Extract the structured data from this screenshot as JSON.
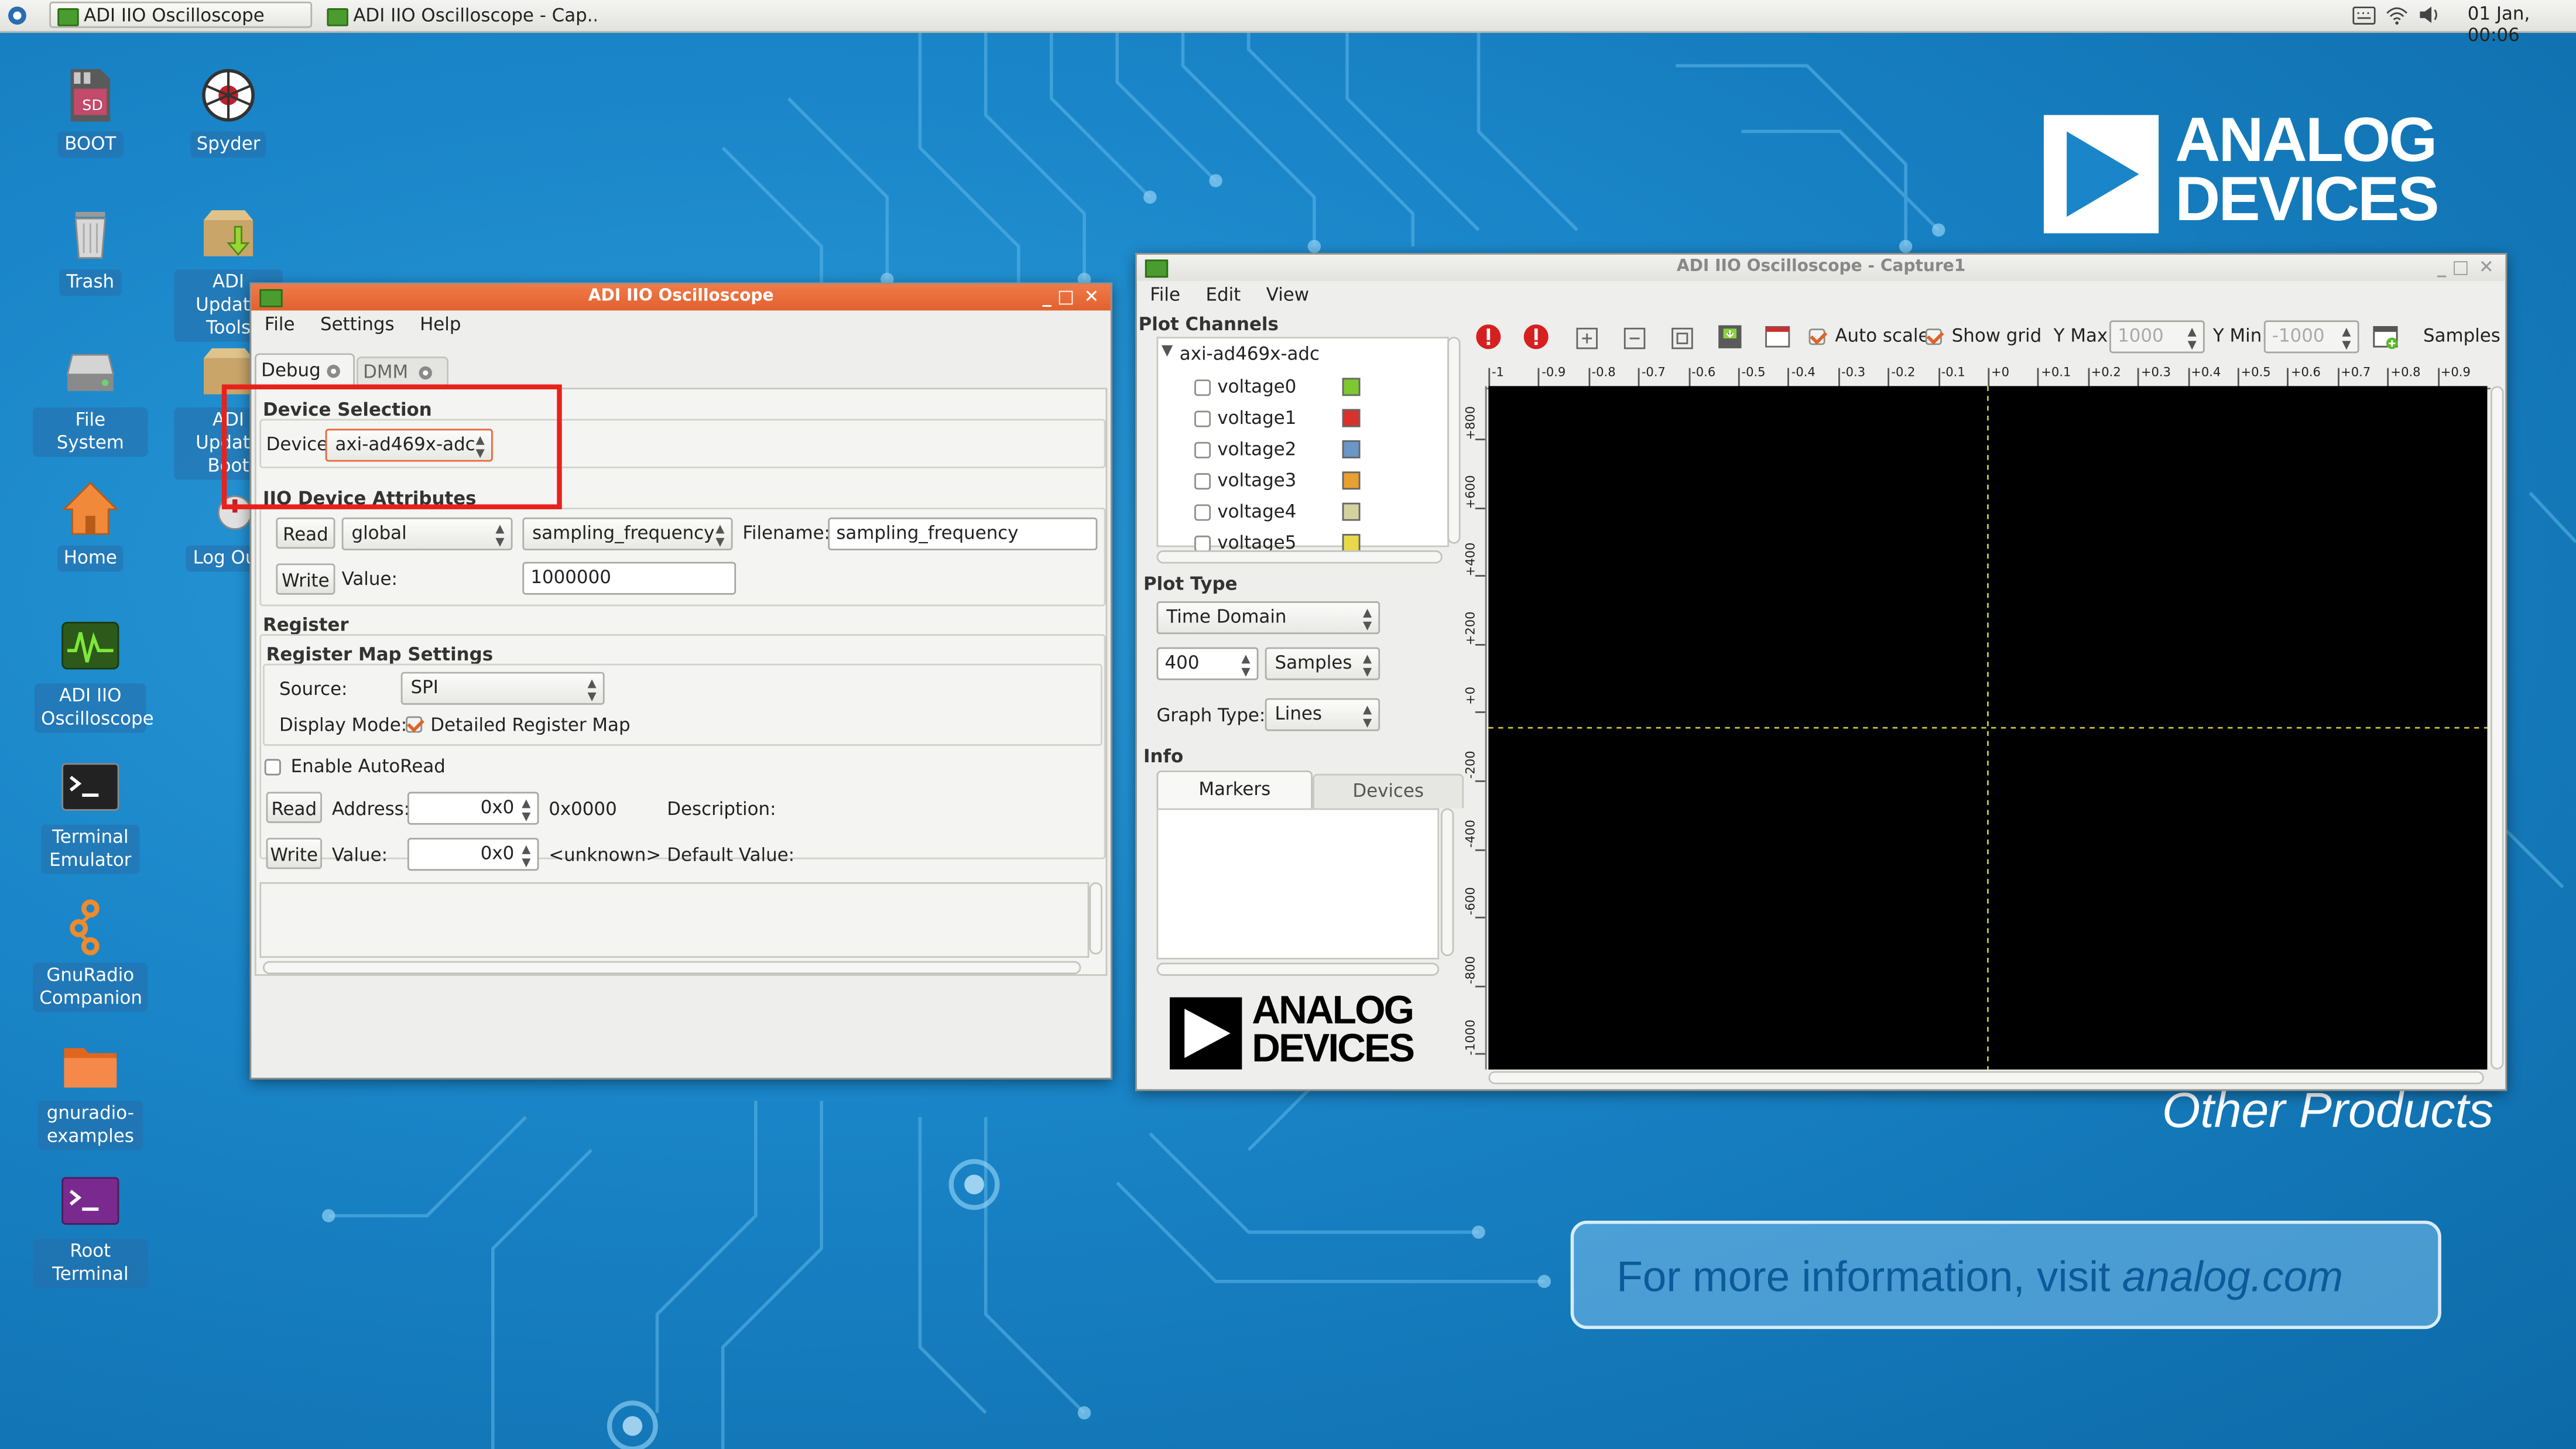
{
  "taskbar": {
    "tasks": [
      "ADI IIO Oscilloscope",
      "ADI IIO Oscilloscope - Cap..."
    ],
    "clock": "01 Jan, 00:06"
  },
  "desktop_icons": [
    {
      "label": "BOOT"
    },
    {
      "label": "Spyder"
    },
    {
      "label": "Trash"
    },
    {
      "label": "ADI Update Tools"
    },
    {
      "label": "File System"
    },
    {
      "label": "ADI Update Boot"
    },
    {
      "label": "Home"
    },
    {
      "label": "Log Out"
    },
    {
      "label": "ADI IIO Oscilloscope"
    },
    {
      "label": "Terminal Emulator"
    },
    {
      "label": "GnuRadio Companion"
    },
    {
      "label": "gnuradio-examples"
    },
    {
      "label": "Root Terminal"
    }
  ],
  "wallpaper": {
    "logo_line1": "ANALOG",
    "logo_line2": "DEVICES",
    "other_products": "Other Products",
    "info_prefix": "For more information, visit ",
    "info_link": "analog.com"
  },
  "debug_window": {
    "title": "ADI IIO Oscilloscope",
    "menu": [
      "File",
      "Settings",
      "Help"
    ],
    "tabs": [
      "Debug",
      "DMM"
    ],
    "device_selection": {
      "header": "Device Selection",
      "device_label": "Device",
      "device_value": "axi-ad469x-adc"
    },
    "attributes": {
      "header": "IIO Device Attributes",
      "read_button": "Read",
      "scope_value": "global",
      "attr_value": "sampling_frequency",
      "filename_label": "Filename:",
      "filename_value": "sampling_frequency",
      "write_button": "Write",
      "value_label": "Value:",
      "value_value": "1000000"
    },
    "register": {
      "header": "Register",
      "map_header": "Register Map Settings",
      "source_label": "Source:",
      "source_value": "SPI",
      "display_label": "Display Mode:",
      "detailed_label": "Detailed Register Map",
      "autoread_label": "Enable AutoRead",
      "read_button": "Read",
      "address_label": "Address:",
      "address_value": "0x0",
      "address_hex": "0x0000",
      "description_label": "Description:",
      "write_button": "Write",
      "value_label": "Value:",
      "value_value": "0x0",
      "value_unknown": "<unknown>",
      "default_label": "Default Value:"
    }
  },
  "capture_window": {
    "title": "ADI IIO Oscilloscope - Capture1",
    "menu": [
      "File",
      "Edit",
      "View"
    ],
    "plot_channels_header": "Plot Channels",
    "device_node": "axi-ad469x-adc",
    "channels": [
      {
        "name": "voltage0",
        "color": "#7ec832"
      },
      {
        "name": "voltage1",
        "color": "#d8322a"
      },
      {
        "name": "voltage2",
        "color": "#6a96c8"
      },
      {
        "name": "voltage3",
        "color": "#e8a030"
      },
      {
        "name": "voltage4",
        "color": "#d6d2a0"
      },
      {
        "name": "voltage5",
        "color": "#e8d84a"
      }
    ],
    "plot_type_header": "Plot Type",
    "plot_type_value": "Time Domain",
    "samples_value": "400",
    "samples_unit": "Samples",
    "graph_type_label": "Graph Type:",
    "graph_type_value": "Lines",
    "info_header": "Info",
    "info_tabs": [
      "Markers",
      "Devices"
    ],
    "toolbar": {
      "auto_scale": "Auto scale",
      "show_grid": "Show grid",
      "ymax_label": "Y Max:",
      "ymax_value": "1000",
      "ymin_label": "Y Min:",
      "ymin_value": "-1000",
      "samples_label": "Samples"
    },
    "logo_line1": "ANALOG",
    "logo_line2": "DEVICES",
    "x_ticks": [
      "-1",
      "-0.9",
      "-0.8",
      "-0.7",
      "-0.6",
      "-0.5",
      "-0.4",
      "-0.3",
      "-0.2",
      "-0.1",
      "+0",
      "+0.1",
      "+0.2",
      "+0.3",
      "+0.4",
      "+0.5",
      "+0.6",
      "+0.7",
      "+0.8",
      "+0.9"
    ],
    "y_ticks": [
      "+800",
      "+600",
      "+400",
      "+200",
      "+0",
      "-200",
      "-400",
      "-600",
      "-800",
      "-1000"
    ]
  },
  "colors": {
    "accent_orange": "#e8693a",
    "highlight_red": "#e8211b",
    "plot_background": "#000000",
    "plot_crosshair": "#c8c83c"
  }
}
